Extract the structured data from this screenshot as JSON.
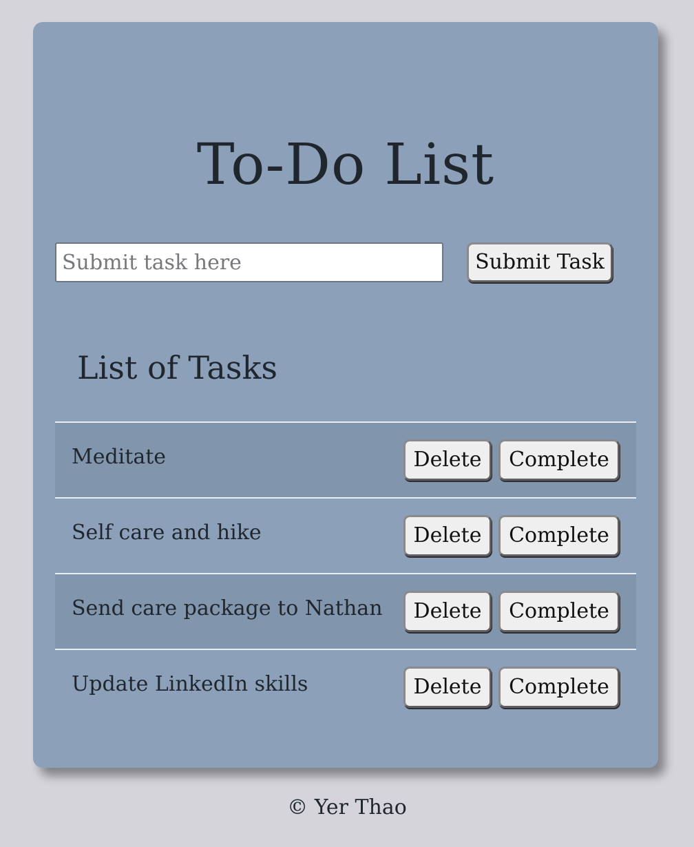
{
  "title": "To-Do List",
  "input": {
    "value": "",
    "placeholder": "Submit task here"
  },
  "submit_label": "Submit Task",
  "list_heading": "List of Tasks",
  "tasks": [
    {
      "text": "Meditate",
      "delete_label": "Delete",
      "complete_label": "Complete"
    },
    {
      "text": "Self care and hike",
      "delete_label": "Delete",
      "complete_label": "Complete"
    },
    {
      "text": "Send care package to Nathan",
      "delete_label": "Delete",
      "complete_label": "Complete"
    },
    {
      "text": "Update LinkedIn skills",
      "delete_label": "Delete",
      "complete_label": "Complete"
    }
  ],
  "footer": "© Yer Thao",
  "colors": {
    "background": "#d4d4da",
    "card": "#8ca1b9",
    "row_shaded": "#8196ad",
    "text": "#1f262e"
  }
}
